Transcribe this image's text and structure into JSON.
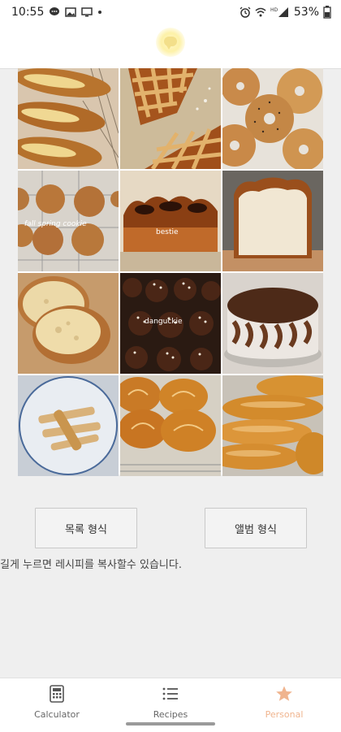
{
  "status_bar": {
    "time": "10:55",
    "battery_text": "53%",
    "left_icons": [
      "chat-bubble-icon",
      "image-icon",
      "screen-cast-icon",
      "dot-icon"
    ],
    "right_icons": [
      "alarm-icon",
      "wifi-icon",
      "hd-signal-icon",
      "battery-icon"
    ]
  },
  "header": {
    "logo_icon": "chat-bubble-logo-icon"
  },
  "gallery": {
    "items": [
      {
        "name": "bread-tile-baguette-rolls"
      },
      {
        "name": "bread-tile-lattice-pie"
      },
      {
        "name": "bread-tile-bagels"
      },
      {
        "name": "bread-tile-cookies",
        "watermark": "fall spring cookie"
      },
      {
        "name": "bread-tile-brioche-loaf",
        "watermark": "bestie"
      },
      {
        "name": "bread-tile-white-loaf"
      },
      {
        "name": "bread-tile-rustic-bread"
      },
      {
        "name": "bread-tile-choco-buns",
        "watermark": "danguckie"
      },
      {
        "name": "bread-tile-chocolate-cake"
      },
      {
        "name": "bread-tile-stick-cookies"
      },
      {
        "name": "bread-tile-swirl-buns"
      },
      {
        "name": "bread-tile-long-rolls"
      }
    ]
  },
  "buttons": {
    "list_view": "목록 형식",
    "album_view": "앨범 형식"
  },
  "hint": "길게 누르면 레시피를 복사할수 있습니다.",
  "bottom_nav": {
    "calculator": "Calculator",
    "recipes": "Recipes",
    "personal": "Personal"
  },
  "colors": {
    "accent": "#f0b48e",
    "header_logo": "#fdf1a8"
  }
}
